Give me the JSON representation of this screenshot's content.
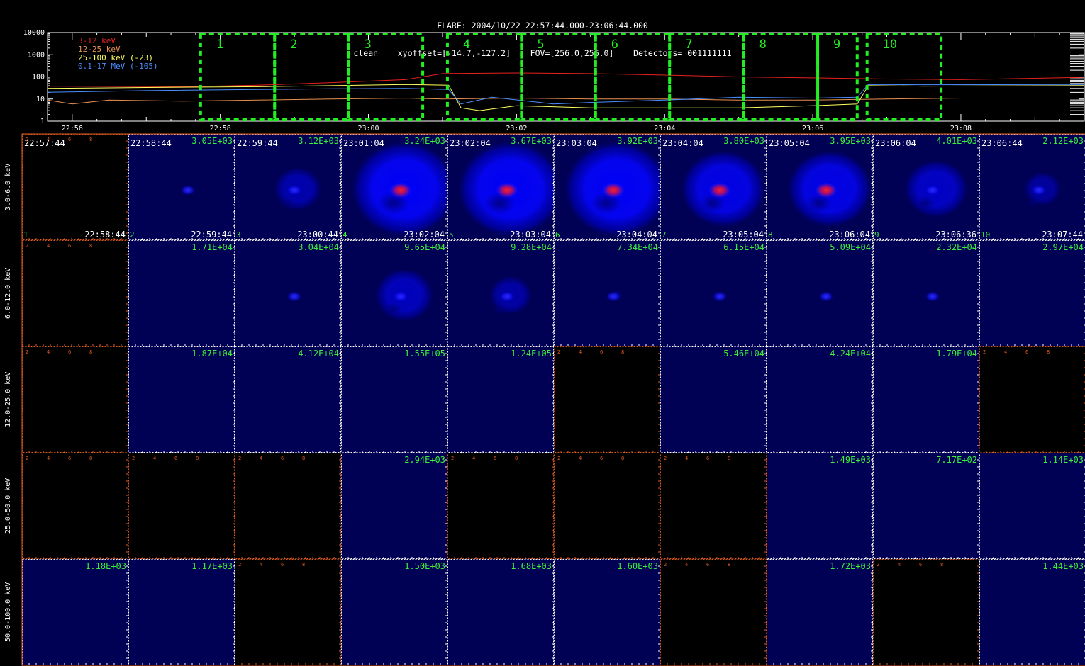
{
  "title": {
    "line1": "FLARE: 2004/10/22 22:57:44.000-23:06:44.000",
    "line2": "clean    xyoffset=[-14.7,-127.2]    FOV=[256.0,256.0]    Detectors= 001111111"
  },
  "colors": {
    "low": "#e82020",
    "mid": "#e89050",
    "high": "#ffff60",
    "gamma": "#4a8fff",
    "box": "#22ee22",
    "green_text": "#3bf03b",
    "axis_orange": "#e05a20"
  },
  "chart_data": [
    {
      "type": "line",
      "x_unit": "UT time",
      "x_ticks": [
        "22:56",
        "22:58",
        "23:00",
        "23:02",
        "23:04",
        "23:06",
        "23:08"
      ],
      "xlim": [
        "22:55:40",
        "23:09:40"
      ],
      "y_scale": "log",
      "y_ticks": [
        "1",
        "10",
        "100",
        "1000",
        "10000"
      ],
      "ylim": [
        1,
        10000
      ],
      "legend_position": "top-left",
      "series": [
        {
          "name": "3-12 keV",
          "color_key": "low",
          "points": [
            [
              "22:55:40",
              38
            ],
            [
              "22:56:30",
              37
            ],
            [
              "22:57:30",
              36
            ],
            [
              "22:58:30",
              42
            ],
            [
              "22:59:30",
              55
            ],
            [
              "23:00:30",
              75
            ],
            [
              "23:01:00",
              140
            ],
            [
              "23:02:00",
              150
            ],
            [
              "23:03:00",
              140
            ],
            [
              "23:04:00",
              120
            ],
            [
              "23:05:00",
              100
            ],
            [
              "23:06:00",
              90
            ],
            [
              "23:07:00",
              80
            ],
            [
              "23:08:00",
              75
            ],
            [
              "23:09:40",
              95
            ]
          ]
        },
        {
          "name": "12-25 keV",
          "color_key": "mid",
          "points": [
            [
              "22:55:40",
              9
            ],
            [
              "22:56:00",
              6
            ],
            [
              "22:56:30",
              9
            ],
            [
              "22:57:30",
              8
            ],
            [
              "22:58:30",
              9
            ],
            [
              "22:59:30",
              10
            ],
            [
              "23:00:30",
              11
            ],
            [
              "23:01:00",
              10
            ],
            [
              "23:02:00",
              11
            ],
            [
              "23:03:00",
              10
            ],
            [
              "23:04:00",
              10
            ],
            [
              "23:05:00",
              9
            ],
            [
              "23:06:00",
              9
            ],
            [
              "23:07:00",
              10
            ],
            [
              "23:08:00",
              11
            ],
            [
              "23:09:40",
              11
            ]
          ]
        },
        {
          "name": "25-100 keV (-23)",
          "color_key": "high",
          "points": [
            [
              "22:55:40",
              30
            ],
            [
              "22:57:00",
              33
            ],
            [
              "22:58:30",
              36
            ],
            [
              "22:59:30",
              40
            ],
            [
              "23:00:30",
              45
            ],
            [
              "23:01:05",
              42
            ],
            [
              "23:01:15",
              4
            ],
            [
              "23:01:30",
              3
            ],
            [
              "23:02:00",
              5
            ],
            [
              "23:03:00",
              4
            ],
            [
              "23:04:00",
              4
            ],
            [
              "23:05:00",
              4
            ],
            [
              "23:06:00",
              5
            ],
            [
              "23:06:36",
              6
            ],
            [
              "23:06:45",
              40
            ],
            [
              "23:07:30",
              38
            ],
            [
              "23:09:40",
              40
            ]
          ]
        },
        {
          "name": "0.1-17 MeV (-105)",
          "color_key": "gamma",
          "points": [
            [
              "22:55:40",
              20
            ],
            [
              "22:57:00",
              24
            ],
            [
              "22:58:30",
              27
            ],
            [
              "22:59:30",
              29
            ],
            [
              "23:00:30",
              30
            ],
            [
              "23:01:05",
              27
            ],
            [
              "23:01:15",
              6
            ],
            [
              "23:01:40",
              12
            ],
            [
              "23:02:30",
              6
            ],
            [
              "23:03:00",
              7
            ],
            [
              "23:04:00",
              9
            ],
            [
              "23:05:00",
              12
            ],
            [
              "23:06:00",
              11
            ],
            [
              "23:06:36",
              12
            ],
            [
              "23:06:45",
              45
            ],
            [
              "23:07:30",
              44
            ],
            [
              "23:09:40",
              45
            ]
          ]
        }
      ],
      "intervals": [
        {
          "label": "1",
          "start": "22:57:44",
          "end": "22:58:44"
        },
        {
          "label": "2",
          "start": "22:58:44",
          "end": "22:59:44"
        },
        {
          "label": "3",
          "start": "22:59:44",
          "end": "23:00:44"
        },
        {
          "label": "4",
          "start": "23:01:04",
          "end": "23:02:04"
        },
        {
          "label": "5",
          "start": "23:02:04",
          "end": "23:03:04"
        },
        {
          "label": "6",
          "start": "23:03:04",
          "end": "23:04:04"
        },
        {
          "label": "7",
          "start": "23:04:04",
          "end": "23:05:04"
        },
        {
          "label": "8",
          "start": "23:05:04",
          "end": "23:06:04"
        },
        {
          "label": "9",
          "start": "23:06:04",
          "end": "23:06:36"
        },
        {
          "label": "10",
          "start": "23:06:44",
          "end": "23:07:44"
        }
      ]
    },
    {
      "type": "heatmap",
      "layout": "image grid",
      "columns": [
        {
          "index": "1",
          "start": "22:57:44",
          "end": "22:58:44"
        },
        {
          "index": "2",
          "start": "22:58:44",
          "end": "22:59:44"
        },
        {
          "index": "3",
          "start": "22:59:44",
          "end": "23:00:44"
        },
        {
          "index": "4",
          "start": "23:01:04",
          "end": "23:02:04"
        },
        {
          "index": "5",
          "start": "23:02:04",
          "end": "23:03:04"
        },
        {
          "index": "6",
          "start": "23:03:04",
          "end": "23:04:04"
        },
        {
          "index": "7",
          "start": "23:04:04",
          "end": "23:05:04"
        },
        {
          "index": "8",
          "start": "23:05:04",
          "end": "23:06:04"
        },
        {
          "index": "9",
          "start": "23:06:04",
          "end": "23:06:36"
        },
        {
          "index": "10",
          "start": "23:06:44",
          "end": "23:07:44"
        }
      ],
      "rows": [
        {
          "label": "3.0-6.0 keV",
          "maxima": [
            "",
            "3.05E+03",
            "3.12E+03",
            "3.24E+03",
            "3.67E+03",
            "3.92E+03",
            "3.80E+03",
            "3.95E+03",
            "4.01E+03",
            "2.12E+03"
          ],
          "intensity": [
            0,
            0.1,
            0.5,
            1,
            1,
            1,
            0.8,
            0.8,
            0.5,
            0.3
          ],
          "ring": [
            0,
            0,
            0.45,
            1,
            1,
            1,
            0.8,
            0.8,
            0.6,
            0.35
          ],
          "core": [
            "none",
            "blue",
            "blue",
            "red",
            "red",
            "red",
            "red",
            "red",
            "blue",
            "blue"
          ]
        },
        {
          "label": "6.0-12.0 keV",
          "maxima": [
            "",
            "1.71E+04",
            "3.04E+04",
            "9.65E+04",
            "9.28E+04",
            "7.34E+04",
            "6.15E+04",
            "5.09E+04",
            "2.32E+04",
            "2.97E+04"
          ],
          "intensity": [
            0,
            0.05,
            0.3,
            0.8,
            0.7,
            0.4,
            0.35,
            0.3,
            0.2,
            0.05
          ],
          "ring": [
            0,
            0,
            0,
            0.55,
            0.4,
            0.1,
            0,
            0,
            0,
            0
          ],
          "core": [
            "none",
            "none",
            "blue",
            "blue",
            "blue",
            "blue",
            "blue",
            "blue",
            "blue",
            "none"
          ]
        },
        {
          "label": "12.0-25.0 keV",
          "maxima": [
            "",
            "1.87E+04",
            "4.12E+04",
            "1.55E+05",
            "1.24E+05",
            "",
            "5.46E+04",
            "4.24E+04",
            "1.79E+04",
            ""
          ],
          "intensity": [
            0,
            0.05,
            0.05,
            0.05,
            0.05,
            0,
            0.05,
            0.05,
            0.05,
            0
          ],
          "ring": [
            0,
            0,
            0,
            0,
            0,
            0,
            0,
            0,
            0,
            0
          ],
          "core": [
            "none",
            "none",
            "none",
            "none",
            "none",
            "none",
            "none",
            "none",
            "none",
            "none"
          ]
        },
        {
          "label": "25.0-50.0 keV",
          "maxima": [
            "",
            "",
            "",
            "2.94E+03",
            "",
            "",
            "",
            "1.49E+03",
            "7.17E+02",
            "1.14E+03"
          ],
          "intensity": [
            0,
            0,
            0,
            0.05,
            0,
            0,
            0,
            0.05,
            0.05,
            0.05
          ],
          "ring": [
            0,
            0,
            0,
            0,
            0,
            0,
            0,
            0,
            0,
            0
          ],
          "core": [
            "none",
            "none",
            "none",
            "none",
            "none",
            "none",
            "none",
            "none",
            "none",
            "none"
          ]
        },
        {
          "label": "50.0-100.0 keV",
          "maxima": [
            "1.18E+03",
            "1.17E+03",
            "",
            "1.50E+03",
            "1.68E+03",
            "1.60E+03",
            "",
            "1.72E+03",
            "",
            "1.44E+03"
          ],
          "intensity": [
            0.05,
            0.05,
            0,
            0.05,
            0.05,
            0.05,
            0,
            0.05,
            0,
            0.05
          ],
          "ring": [
            0,
            0,
            0,
            0,
            0,
            0,
            0,
            0,
            0,
            0
          ],
          "core": [
            "none",
            "none",
            "none",
            "none",
            "none",
            "none",
            "none",
            "none",
            "none",
            "none"
          ]
        }
      ],
      "axis_ticks": [
        "2",
        "4",
        "6",
        "8"
      ]
    }
  ]
}
